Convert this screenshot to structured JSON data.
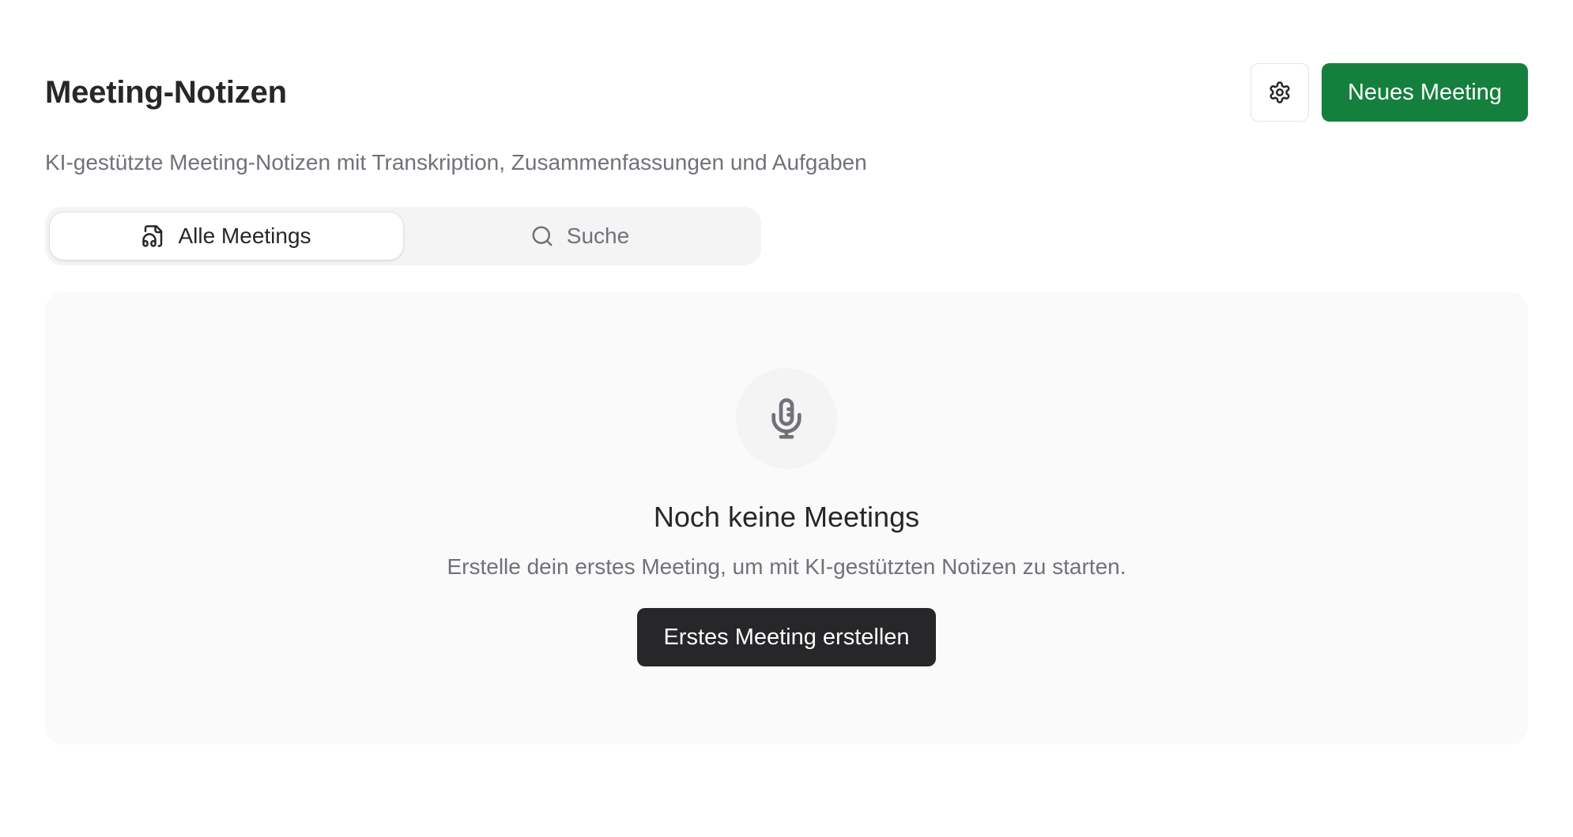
{
  "header": {
    "title": "Meeting-Notizen",
    "new_meeting_label": "Neues Meeting",
    "settings_icon": "gear-icon"
  },
  "subtitle": "KI-gestützte Meeting-Notizen mit Transkription, Zusammenfassungen und Aufgaben",
  "tabs": [
    {
      "label": "Alle Meetings",
      "icon": "file-audio-icon",
      "active": true
    },
    {
      "label": "Suche",
      "icon": "search-icon",
      "active": false
    }
  ],
  "empty_state": {
    "icon": "microphone-icon",
    "title": "Noch keine Meetings",
    "text": "Erstelle dein erstes Meeting, um mit KI-gestützten Notizen zu starten.",
    "button_label": "Erstes Meeting erstellen"
  },
  "colors": {
    "primary": "#15803d",
    "dark": "#27272a",
    "muted_text": "#71717a",
    "panel_bg": "#fafafa"
  }
}
